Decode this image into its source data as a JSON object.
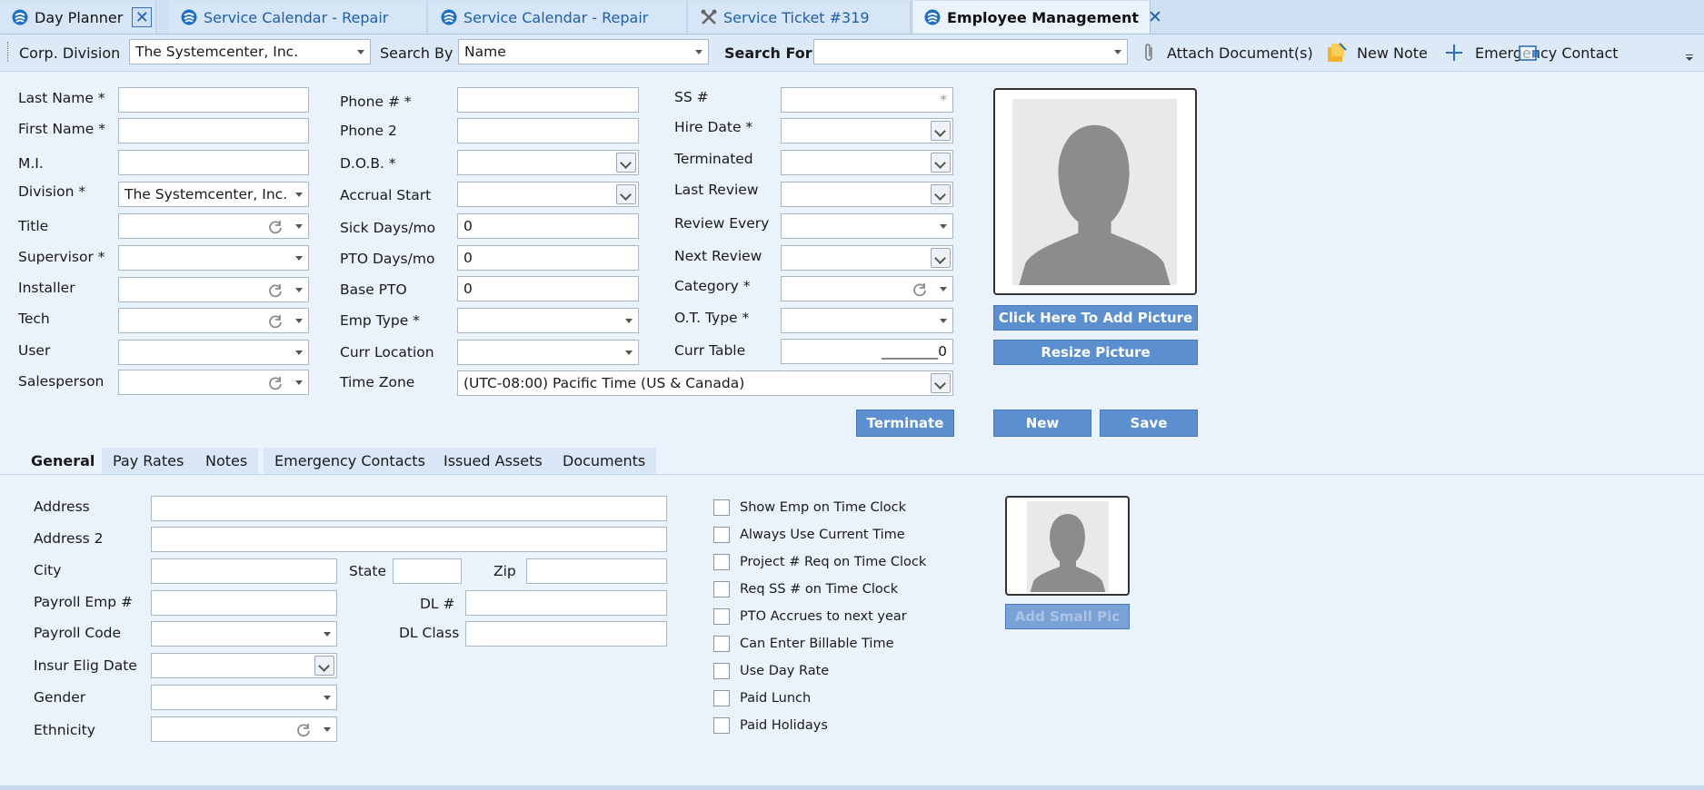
{
  "tabs": [
    {
      "label": "Day Planner"
    },
    {
      "label": "Service Calendar - Repair"
    },
    {
      "label": "Service Calendar - Repair"
    },
    {
      "label": "Service Ticket #319"
    },
    {
      "label": "Employee Management"
    }
  ],
  "toolbar": {
    "corp_division_label": "Corp. Division",
    "corp_division_value": "The Systemcenter, Inc.",
    "search_by_label": "Search By",
    "search_by_value": "Name",
    "search_for_label": "Search For",
    "search_for_value": "",
    "attach_label": "Attach Document(s)",
    "new_note_label": "New Note",
    "emergency_label": "Emergency Contact"
  },
  "form": {
    "col1": {
      "last_name": "Last Name *",
      "first_name": "First Name *",
      "mi": "M.I.",
      "division": "Division *",
      "division_value": "The Systemcenter, Inc.",
      "title": "Title",
      "supervisor": "Supervisor *",
      "installer": "Installer",
      "tech": "Tech",
      "user": "User",
      "salesperson": "Salesperson"
    },
    "col2": {
      "phone": "Phone # *",
      "phone2": "Phone 2",
      "dob": "D.O.B. *",
      "accrual_start": "Accrual Start",
      "sick_days": "Sick Days/mo",
      "sick_days_value": "0",
      "pto_days": "PTO Days/mo",
      "pto_days_value": "0",
      "base_pto": "Base PTO",
      "base_pto_value": "0",
      "emp_type": "Emp Type *",
      "curr_location": "Curr Location",
      "time_zone": "Time Zone",
      "time_zone_value": "(UTC-08:00) Pacific Time (US & Canada)"
    },
    "col3": {
      "ss": "SS #",
      "ss_value": "*",
      "hire_date": "Hire Date *",
      "terminated": "Terminated",
      "last_review": "Last Review",
      "review_every": "Review Every",
      "next_review": "Next Review",
      "category": "Category *",
      "ot_type": "O.T. Type *",
      "curr_table": "Curr Table",
      "curr_table_value": "________0"
    }
  },
  "buttons": {
    "add_picture": "Click Here To Add Picture",
    "resize_picture": "Resize Picture",
    "terminate": "Terminate",
    "new": "New",
    "save": "Save",
    "add_small_pic": "Add Small Pic"
  },
  "subtabs": [
    {
      "label": "General"
    },
    {
      "label": "Pay Rates"
    },
    {
      "label": "Notes"
    },
    {
      "label": "Emergency Contacts"
    },
    {
      "label": "Issued Assets"
    },
    {
      "label": "Documents"
    }
  ],
  "general": {
    "address": "Address",
    "address2": "Address 2",
    "city": "City",
    "state": "State",
    "zip": "Zip",
    "payroll_emp": "Payroll Emp #",
    "dl": "DL #",
    "payroll_code": "Payroll Code",
    "dl_class": "DL Class",
    "insur_elig_date": "Insur Elig Date",
    "gender": "Gender",
    "ethnicity": "Ethnicity"
  },
  "checkboxes": [
    {
      "label": "Show Emp on Time Clock",
      "checked": false
    },
    {
      "label": "Always Use Current Time",
      "checked": false
    },
    {
      "label": "Project # Req on Time Clock",
      "checked": false
    },
    {
      "label": "Req SS # on Time Clock",
      "checked": false
    },
    {
      "label": "PTO Accrues to next year",
      "checked": false
    },
    {
      "label": "Can Enter Billable Time",
      "checked": false
    },
    {
      "label": "Use Day Rate",
      "checked": false
    },
    {
      "label": "Paid Lunch",
      "checked": false
    },
    {
      "label": "Paid Holidays",
      "checked": false
    }
  ],
  "colors": {
    "accent": "#5b8fd0",
    "tab_blue": "#1f5fa8",
    "background": "#eaf3fc"
  }
}
